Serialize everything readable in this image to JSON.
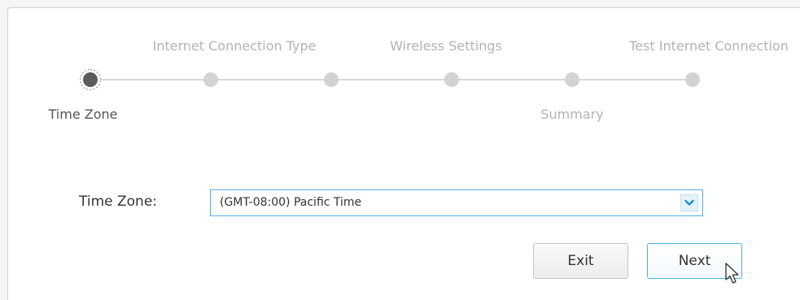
{
  "wizard": {
    "steps": [
      {
        "label": "Time Zone",
        "state": "active"
      },
      {
        "label": "Internet Connection Type",
        "state": "pending"
      },
      {
        "label": "Wireless Settings",
        "state": "pending"
      },
      {
        "label": "Summary",
        "state": "pending"
      },
      {
        "label": "Test Internet Connection",
        "state": "pending"
      }
    ]
  },
  "form": {
    "timezone_label": "Time Zone:",
    "timezone_value": "(GMT-08:00) Pacific Time"
  },
  "buttons": {
    "exit_label": "Exit",
    "next_label": "Next"
  },
  "icons": {
    "dropdown": "chevron-down-icon",
    "cursor": "mouse-pointer-icon"
  },
  "colors": {
    "accent": "#4fb3e8",
    "active_step": "#5c5c5c",
    "inactive_step": "#d3d3d3"
  }
}
